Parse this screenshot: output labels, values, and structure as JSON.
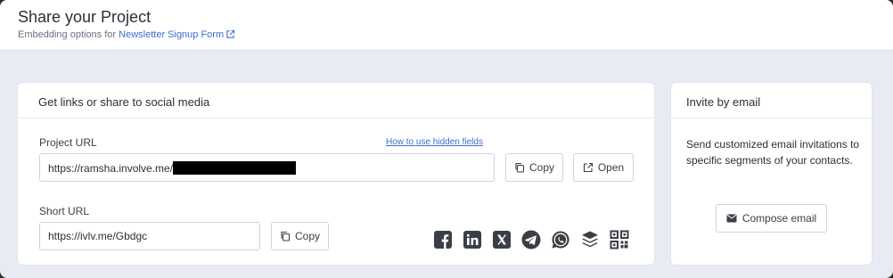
{
  "header": {
    "title": "Share your Project",
    "subtitle_prefix": "Embedding options for",
    "project_link": "Newsletter Signup Form"
  },
  "share_card": {
    "title": "Get links or share to social media",
    "project_url": {
      "label": "Project URL",
      "hint_link": "How to use hidden fields",
      "value": "https://ramsha.involve.me/",
      "copy_label": "Copy",
      "open_label": "Open"
    },
    "short_url": {
      "label": "Short URL",
      "value": "https://ivlv.me/Gbdgc",
      "copy_label": "Copy"
    },
    "social_icons": [
      "facebook-icon",
      "linkedin-icon",
      "x-icon",
      "telegram-icon",
      "whatsapp-icon",
      "buffer-icon",
      "qr-code-icon"
    ]
  },
  "invite_card": {
    "title": "Invite by email",
    "description": "Send customized email invitations to specific segments of your contacts.",
    "compose_label": "Compose email"
  },
  "colors": {
    "accent_link": "#3b6fd1",
    "page_bg": "#e8ebf3",
    "icon_dark": "#3a3f47"
  }
}
